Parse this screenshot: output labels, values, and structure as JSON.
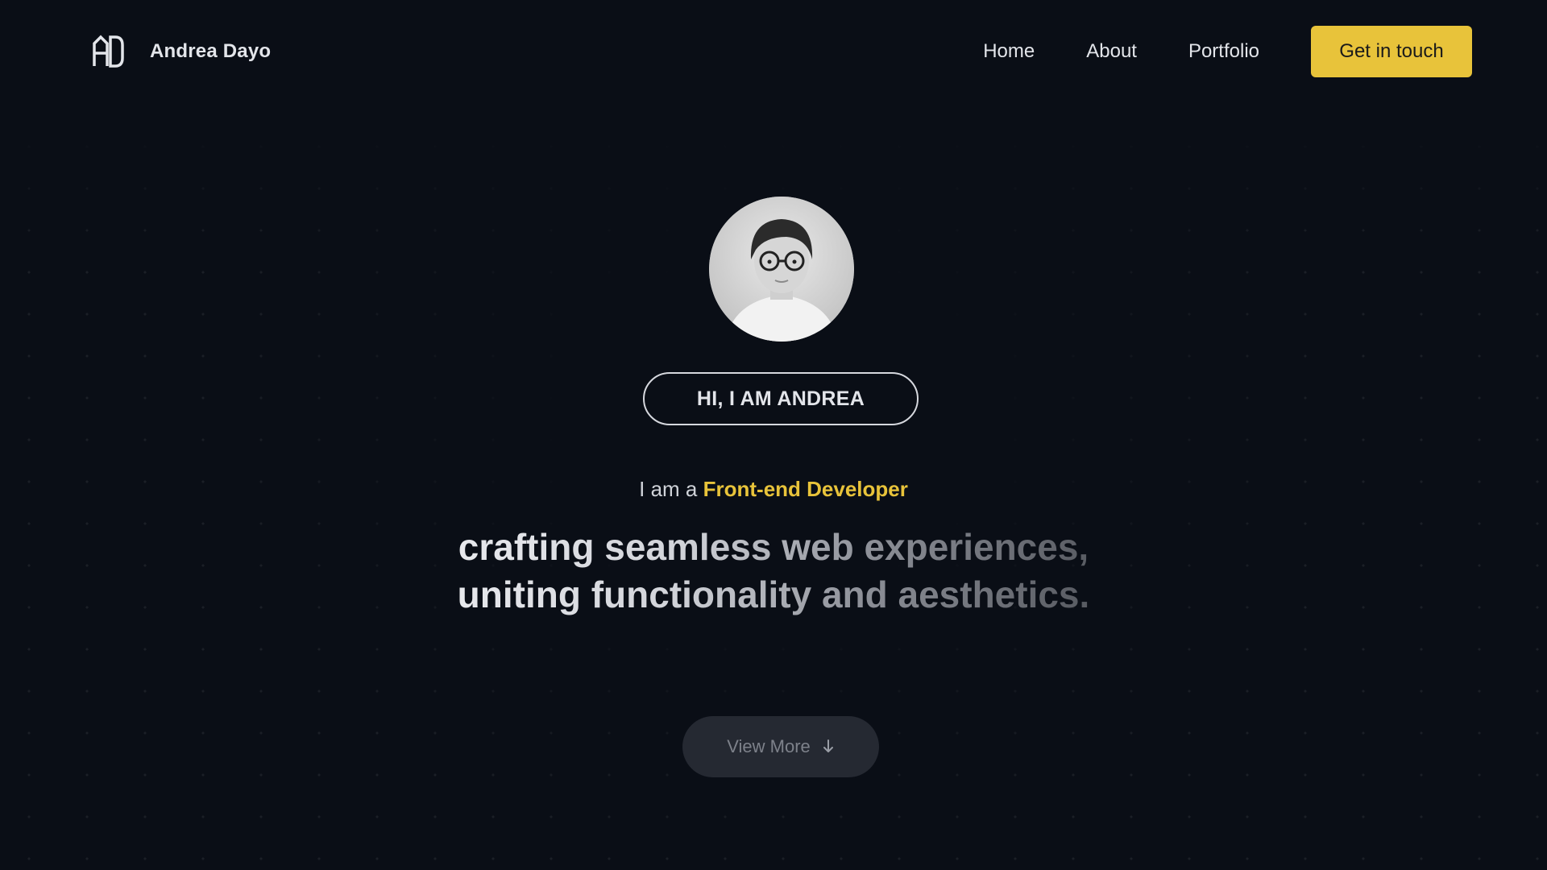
{
  "header": {
    "brand_name": "Andrea Dayo",
    "logo_icon": "ad-monogram-logo",
    "nav": [
      {
        "label": "Home"
      },
      {
        "label": "About"
      },
      {
        "label": "Portfolio"
      }
    ],
    "cta_label": "Get in touch"
  },
  "hero": {
    "avatar_icon": "profile-photo-avatar",
    "badge_text": "HI, I AM ANDREA",
    "role_prefix": "I am a",
    "role_highlight": "Front-end Developer",
    "headline": "crafting seamless web experiences, uniting functionality and aesthetics.",
    "view_more_label": "View More",
    "view_more_icon": "arrow-down-icon"
  },
  "colors": {
    "background": "#0a0e16",
    "accent": "#e8c33a",
    "button_muted": "#252932"
  }
}
